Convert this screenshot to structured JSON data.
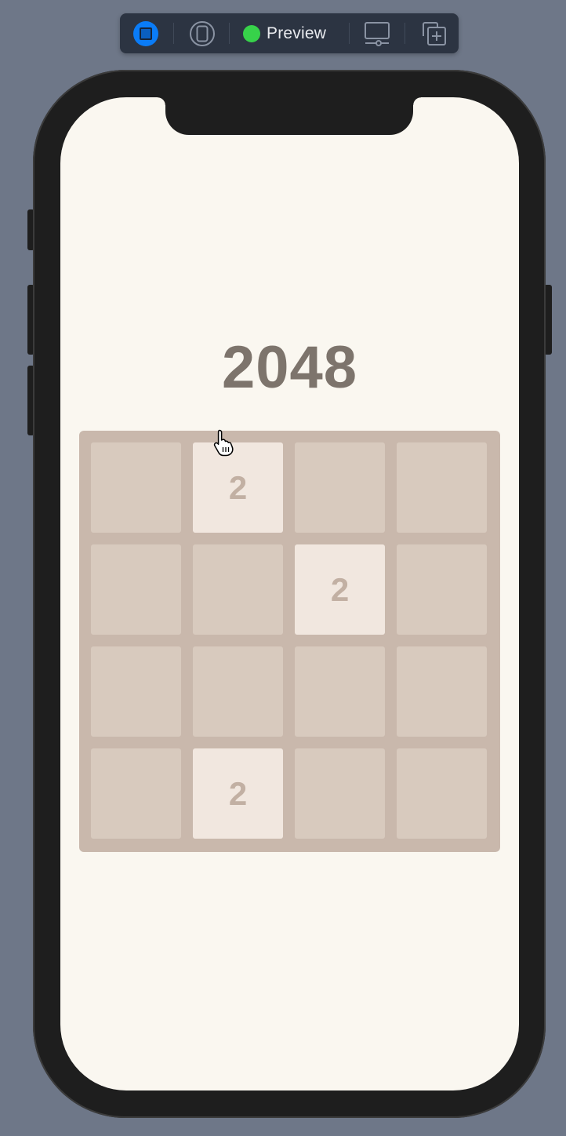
{
  "toolbar": {
    "live_icon": "play-stop-icon",
    "variants_icon": "variants-icon",
    "preview_label": "Preview",
    "status_color": "#37d24a",
    "device_icon": "device-settings-icon",
    "duplicate_icon": "duplicate-preview-icon"
  },
  "game": {
    "title": "2048",
    "board_color": "#c9b8ac",
    "empty_tile_color": "#d8cabe",
    "filled_tile_color": "#f1e7df",
    "grid": [
      [
        "",
        "2",
        "",
        ""
      ],
      [
        "",
        "",
        "2",
        ""
      ],
      [
        "",
        "",
        "",
        ""
      ],
      [
        "",
        "2",
        "",
        ""
      ]
    ]
  },
  "cursor": {
    "icon": "pointing-hand-cursor-icon"
  }
}
